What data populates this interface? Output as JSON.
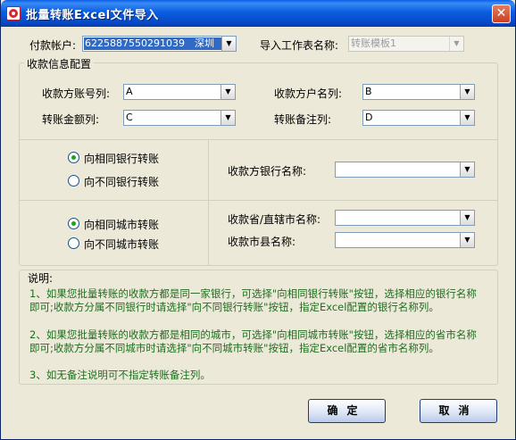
{
  "window": {
    "title": "批量转账Excel文件导入",
    "close_label": "✕"
  },
  "top": {
    "account_label": "付款帐户:",
    "account_number": "6225887550291039",
    "account_city": "深圳",
    "worksheet_label": "导入工作表名称:",
    "worksheet_value": "转账模板1"
  },
  "config": {
    "group_title": "收款信息配置",
    "payee_account_label": "收款方账号列:",
    "payee_account_value": "A",
    "payee_name_label": "收款方户名列:",
    "payee_name_value": "B",
    "amount_label": "转账金额列:",
    "amount_value": "C",
    "remark_label": "转账备注列:",
    "remark_value": "D",
    "same_bank_label": "向相同银行转账",
    "diff_bank_label": "向不同银行转账",
    "bank_name_label": "收款方银行名称:",
    "bank_name_value": "",
    "same_city_label": "向相同城市转账",
    "diff_city_label": "向不同城市转账",
    "province_label": "收款省/直辖市名称:",
    "province_value": "",
    "city_label": "收款市县名称:",
    "city_value": ""
  },
  "notes": {
    "title": "说明:",
    "items": [
      "1、如果您批量转账的收款方都是同一家银行，可选择\"向相同银行转账\"按钮，选择相应的银行名称即可;收款方分属不同银行时请选择\"向不同银行转账\"按钮，指定Excel配置的银行名称列。",
      "2、如果您批量转账的收款方都是相同的城市，可选择\"向相同城市转账\"按钮，选择相应的省市名称即可;收款方分属不同城市时请选择\"向不同城市转账\"按钮，指定Excel配置的省市名称列。",
      "3、如无备注说明可不指定转账备注列。"
    ]
  },
  "buttons": {
    "ok": "确定",
    "cancel": "取消"
  }
}
